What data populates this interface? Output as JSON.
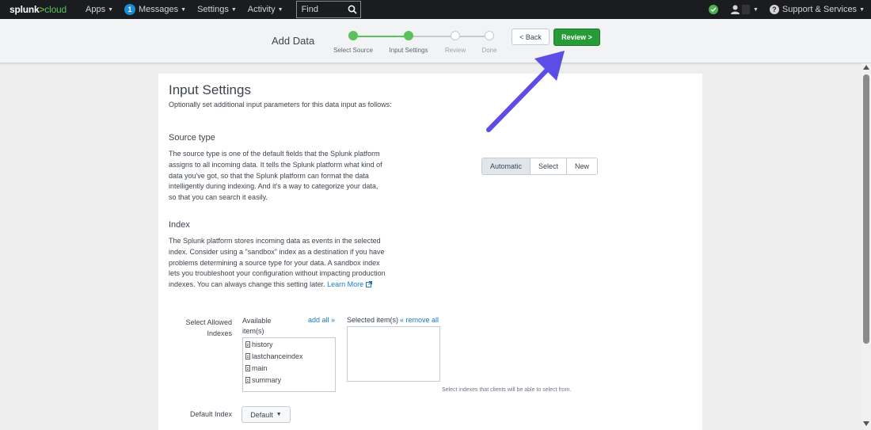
{
  "nav": {
    "logo_prefix": "splunk",
    "logo_gt": ">",
    "logo_suffix": "cloud",
    "apps": "Apps",
    "messages_count": "1",
    "messages": "Messages",
    "settings": "Settings",
    "activity": "Activity",
    "find_placeholder": "Find",
    "support": "Support & Services"
  },
  "wizard": {
    "title": "Add Data",
    "steps": [
      {
        "label": "Select Source",
        "status": "done"
      },
      {
        "label": "Input Settings",
        "status": "done"
      },
      {
        "label": "Review",
        "status": "todo"
      },
      {
        "label": "Done",
        "status": "todo"
      }
    ],
    "back_label": "< Back",
    "review_label": "Review >"
  },
  "content": {
    "title": "Input Settings",
    "subtitle": "Optionally set additional input parameters for this data input as follows:",
    "source_type": {
      "heading": "Source type",
      "description": "The source type is one of the default fields that the Splunk platform assigns to all incoming data. It tells the Splunk platform what kind of data you've got, so that the Splunk platform can format the data intelligently during indexing. And it's a way to categorize your data, so that you can search it easily.",
      "options": [
        "Automatic",
        "Select",
        "New"
      ],
      "selected": "Automatic"
    },
    "index": {
      "heading": "Index",
      "description": "The Splunk platform stores incoming data as events in the selected index. Consider using a \"sandbox\" index as a destination if you have problems determining a source type for your data. A sandbox index lets you troubleshoot your configuration without impacting production indexes. You can always change this setting later.",
      "learn_more": "Learn More"
    },
    "allowed_indexes": {
      "label": "Select Allowed Indexes",
      "available_label": "Available item(s)",
      "add_all": "add all »",
      "selected_label": "Selected item(s)",
      "remove_all": "« remove all",
      "available_items": [
        "history",
        "lastchanceindex",
        "main",
        "summary"
      ],
      "hint": "Select indexes that clients will be able to select from."
    },
    "default_index": {
      "label": "Default Index",
      "value": "Default"
    }
  },
  "colors": {
    "accent_green": "#279b37",
    "annotation_arrow": "#5b4de6",
    "link": "#1a7abf"
  }
}
